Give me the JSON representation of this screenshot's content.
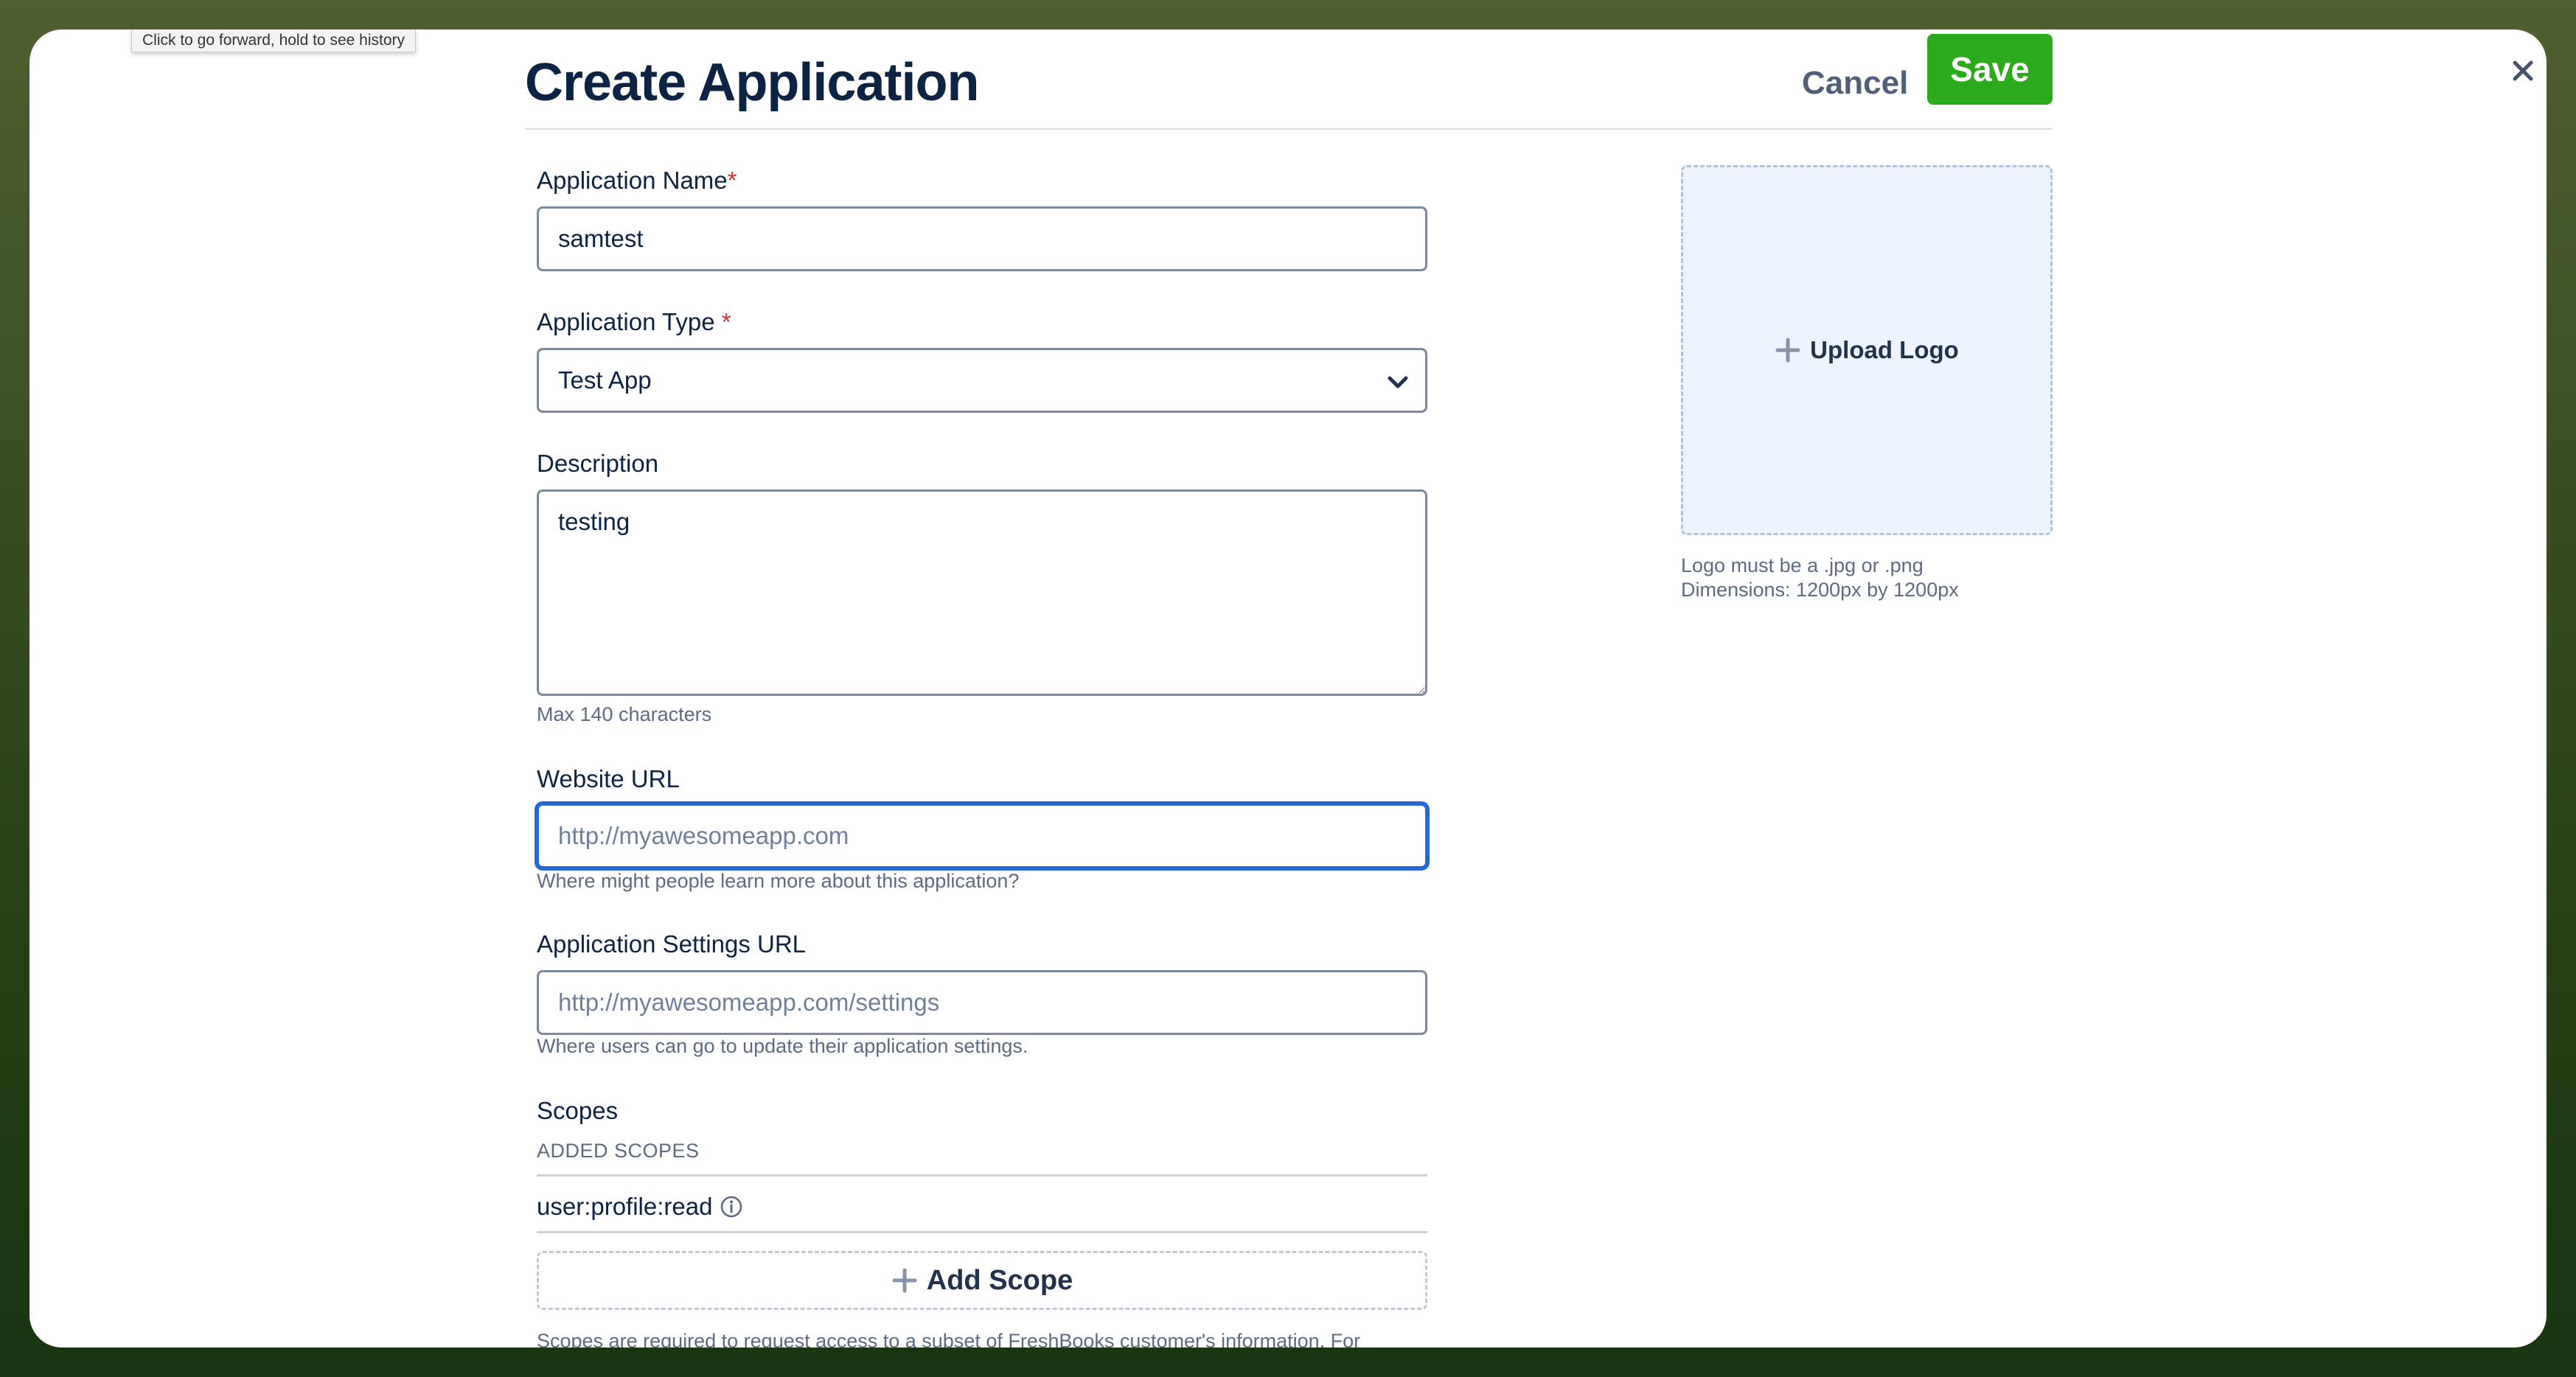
{
  "browser": {
    "tooltip": "Click to go forward, hold to see history"
  },
  "header": {
    "title": "Create Application",
    "cancel_label": "Cancel",
    "save_label": "Save",
    "save_color": "#2bab1b"
  },
  "form": {
    "name": {
      "label": "Application Name",
      "required_mark": "*",
      "value": "samtest"
    },
    "type": {
      "label": "Application Type",
      "required_mark": "*",
      "selected": "Test App"
    },
    "description": {
      "label": "Description",
      "value": "testing",
      "help": "Max 140 characters"
    },
    "website_url": {
      "label": "Website URL",
      "placeholder": "http://myawesomeapp.com",
      "help": "Where might people learn more about this application?",
      "focus_color": "#2769d2"
    },
    "settings_url": {
      "label": "Application Settings URL",
      "placeholder": "http://myawesomeapp.com/settings",
      "help": "Where users can go to update their application settings."
    },
    "scopes": {
      "label": "Scopes",
      "added_heading": "ADDED SCOPES",
      "items": [
        "user:profile:read"
      ],
      "add_label": "Add Scope",
      "note": "Scopes are required to request access to a subset of FreshBooks customer's information. For"
    }
  },
  "logo": {
    "upload_label": "Upload Logo",
    "note_format": "Logo must be a .jpg or .png",
    "note_dimensions": "Dimensions: 1200px by 1200px"
  },
  "icons": [
    "close-icon",
    "chevron-down-icon",
    "plus-icon",
    "info-icon"
  ]
}
